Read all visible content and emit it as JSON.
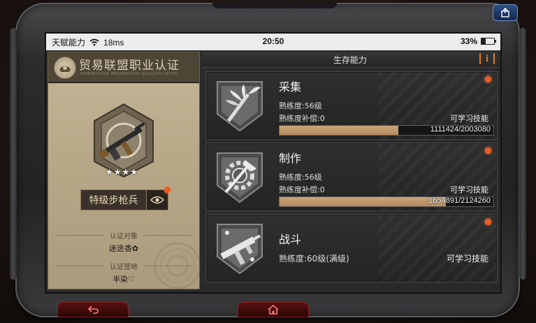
{
  "status_bar": {
    "carrier": "天赋能力",
    "signal": "18ms",
    "time": "20:50",
    "battery": "33%",
    "battery_level": 0.33
  },
  "card": {
    "title": "贸易联盟职业认证",
    "subtitle": "FEDERATION PROFESSION QUALIFICATION",
    "rank_stars": 4,
    "rank_label": "特级步枪兵",
    "target_label": "认证对象",
    "target_value": "迷迭香✿",
    "camp_label": "认证营地",
    "camp_value": "半染♡"
  },
  "panel": {
    "title": "生存能力",
    "info_label": "i"
  },
  "skills": [
    {
      "name": "采集",
      "level_text": "熟练度:56级",
      "compensation_text": "熟练度补偿:0",
      "learnable": "可学习技能",
      "progress_text": "1111424/2003080",
      "progress": 0.555,
      "icon": "leaf-shield-icon"
    },
    {
      "name": "制作",
      "level_text": "熟练度:56级",
      "compensation_text": "熟练度补偿:0",
      "learnable": "可学习技能",
      "progress_text": "1654891/2124260",
      "progress": 0.779,
      "icon": "gear-hammer-icon"
    },
    {
      "name": "战斗",
      "level_text": "熟练度:60级(满级)",
      "learnable": "可学习技能",
      "icon": "smg-shield-icon"
    }
  ],
  "colors": {
    "accent_orange": "#e07b22",
    "alert_red": "#f05a24",
    "progress_fill": "#b38a5c",
    "card_bg": "#b7a888"
  }
}
